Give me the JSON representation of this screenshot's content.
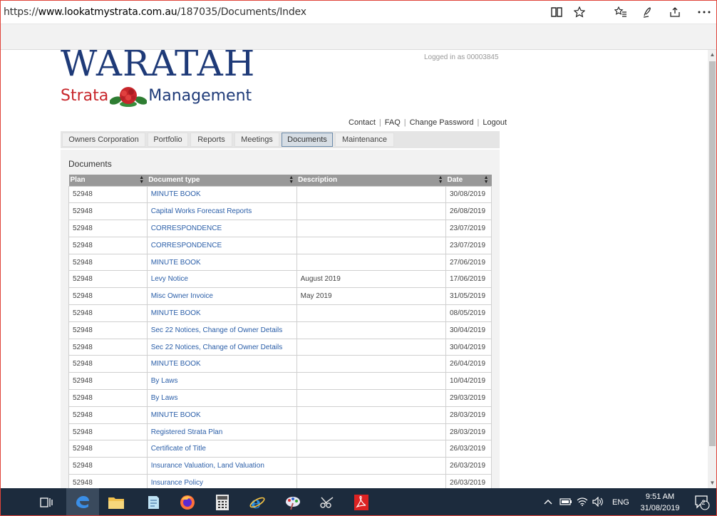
{
  "browser": {
    "url_scheme": "https://",
    "url_host": "www.lookatmystrata.com.au",
    "url_path": "/187035/Documents/Index"
  },
  "header": {
    "logo_main": "WARATAH",
    "logo_strata": "Strata",
    "logo_management": "Management",
    "logged_in": "Logged in as 00003845"
  },
  "toplinks": {
    "contact": "Contact",
    "faq": "FAQ",
    "change_password": "Change Password",
    "logout": "Logout"
  },
  "tabs": [
    {
      "label": "Owners Corporation"
    },
    {
      "label": "Portfolio"
    },
    {
      "label": "Reports"
    },
    {
      "label": "Meetings"
    },
    {
      "label": "Documents"
    },
    {
      "label": "Maintenance"
    }
  ],
  "documents": {
    "title": "Documents",
    "columns": {
      "plan": "Plan",
      "type": "Document type",
      "description": "Description",
      "date": "Date"
    },
    "rows": [
      {
        "plan": "52948",
        "type": "MINUTE BOOK",
        "description": "",
        "date": "30/08/2019"
      },
      {
        "plan": "52948",
        "type": "Capital Works Forecast Reports",
        "description": "",
        "date": "26/08/2019"
      },
      {
        "plan": "52948",
        "type": "CORRESPONDENCE",
        "description": "",
        "date": "23/07/2019"
      },
      {
        "plan": "52948",
        "type": "CORRESPONDENCE",
        "description": "",
        "date": "23/07/2019"
      },
      {
        "plan": "52948",
        "type": "MINUTE BOOK",
        "description": "",
        "date": "27/06/2019"
      },
      {
        "plan": "52948",
        "type": "Levy Notice",
        "description": "August 2019",
        "date": "17/06/2019"
      },
      {
        "plan": "52948",
        "type": "Misc Owner Invoice",
        "description": "May 2019",
        "date": "31/05/2019"
      },
      {
        "plan": "52948",
        "type": "MINUTE BOOK",
        "description": "",
        "date": "08/05/2019"
      },
      {
        "plan": "52948",
        "type": "Sec 22 Notices, Change of Owner Details",
        "description": "",
        "date": "30/04/2019"
      },
      {
        "plan": "52948",
        "type": "Sec 22 Notices, Change of Owner Details",
        "description": "",
        "date": "30/04/2019"
      },
      {
        "plan": "52948",
        "type": "MINUTE BOOK",
        "description": "",
        "date": "26/04/2019"
      },
      {
        "plan": "52948",
        "type": "By Laws",
        "description": "",
        "date": "10/04/2019"
      },
      {
        "plan": "52948",
        "type": "By Laws",
        "description": "",
        "date": "29/03/2019"
      },
      {
        "plan": "52948",
        "type": "MINUTE BOOK",
        "description": "",
        "date": "28/03/2019"
      },
      {
        "plan": "52948",
        "type": "Registered Strata Plan",
        "description": "",
        "date": "28/03/2019"
      },
      {
        "plan": "52948",
        "type": "Certificate of Title",
        "description": "",
        "date": "26/03/2019"
      },
      {
        "plan": "52948",
        "type": "Insurance Valuation, Land Valuation",
        "description": "",
        "date": "26/03/2019"
      },
      {
        "plan": "52948",
        "type": "Insurance Policy",
        "description": "",
        "date": "26/03/2019"
      }
    ]
  },
  "taskbar": {
    "language": "ENG",
    "time": "9:51 AM",
    "date": "31/08/2019",
    "notifications": "2"
  },
  "colors": {
    "brand_blue": "#1e3a78",
    "brand_red": "#c8262b",
    "link_blue": "#2a5ea8",
    "taskbar": "#1c2b3d"
  }
}
